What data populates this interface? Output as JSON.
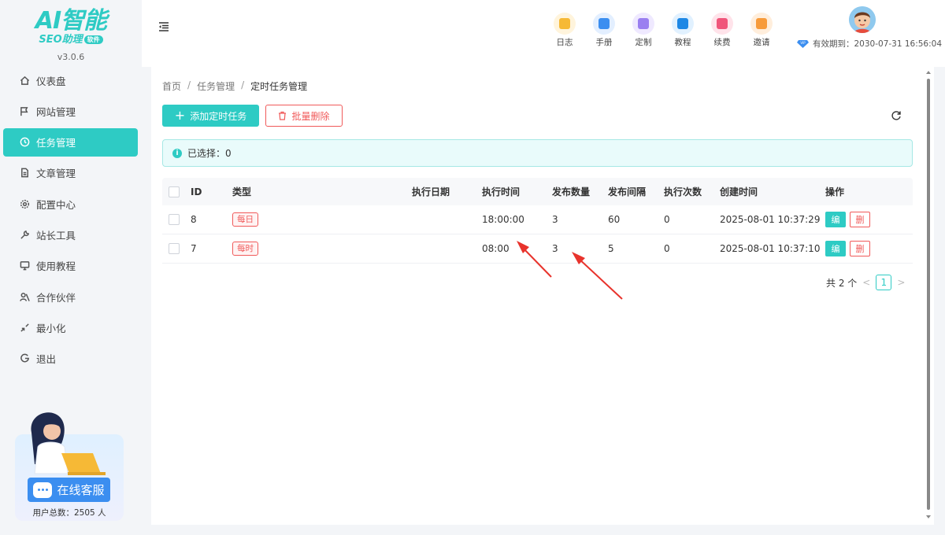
{
  "app": {
    "logo_main": "AI智能",
    "logo_sub": "SEO助理",
    "logo_badge": "软件",
    "version": "v3.0.6"
  },
  "sidebar": {
    "items": [
      {
        "label": "仪表盘",
        "icon": "home-icon"
      },
      {
        "label": "网站管理",
        "icon": "flag-icon"
      },
      {
        "label": "任务管理",
        "icon": "clock-icon",
        "active": true
      },
      {
        "label": "文章管理",
        "icon": "document-icon"
      },
      {
        "label": "配置中心",
        "icon": "gear-icon"
      },
      {
        "label": "站长工具",
        "icon": "wrench-icon"
      },
      {
        "label": "使用教程",
        "icon": "monitor-icon"
      },
      {
        "label": "合作伙伴",
        "icon": "partner-icon"
      },
      {
        "label": "最小化",
        "icon": "minimize-icon"
      },
      {
        "label": "退出",
        "icon": "logout-icon"
      }
    ],
    "service_label": "在线客服",
    "user_count": "用户总数：2505 人"
  },
  "header": {
    "tools": [
      {
        "label": "日志",
        "color": "#f6b936",
        "bg": "#fff4dc"
      },
      {
        "label": "手册",
        "color": "#3b8ef0",
        "bg": "#e3efff"
      },
      {
        "label": "定制",
        "color": "#9a7ff0",
        "bg": "#efe9ff"
      },
      {
        "label": "教程",
        "color": "#1e88e5",
        "bg": "#e1f1ff"
      },
      {
        "label": "续费",
        "color": "#f0557a",
        "bg": "#ffe3ea"
      },
      {
        "label": "邀请",
        "color": "#f79b3b",
        "bg": "#ffeedc"
      }
    ],
    "validity": "有效期到：2030-07-31 16:56:04"
  },
  "breadcrumb": [
    "首页",
    "任务管理",
    "定时任务管理"
  ],
  "toolbar": {
    "add_label": "添加定时任务",
    "batch_delete_label": "批量删除"
  },
  "selection": {
    "text": "已选择：0"
  },
  "table": {
    "columns": [
      "ID",
      "类型",
      "执行日期",
      "执行时间",
      "发布数量",
      "发布间隔",
      "执行次数",
      "创建时间",
      "操作"
    ],
    "rows": [
      {
        "id": "8",
        "type": "每日",
        "date": "",
        "time": "18:00:00",
        "count": "3",
        "interval": "60",
        "runs": "0",
        "created": "2025-08-01 10:37:29"
      },
      {
        "id": "7",
        "type": "每时",
        "date": "",
        "time": "08:00",
        "count": "3",
        "interval": "5",
        "runs": "0",
        "created": "2025-08-01 10:37:10"
      }
    ],
    "edit_label": "编",
    "delete_label": "删"
  },
  "pagination": {
    "total": "共 2 个",
    "current_page": "1"
  },
  "colors": {
    "accent": "#2ecbc4",
    "danger": "#f05a5a",
    "annotation": "#e8332c"
  }
}
